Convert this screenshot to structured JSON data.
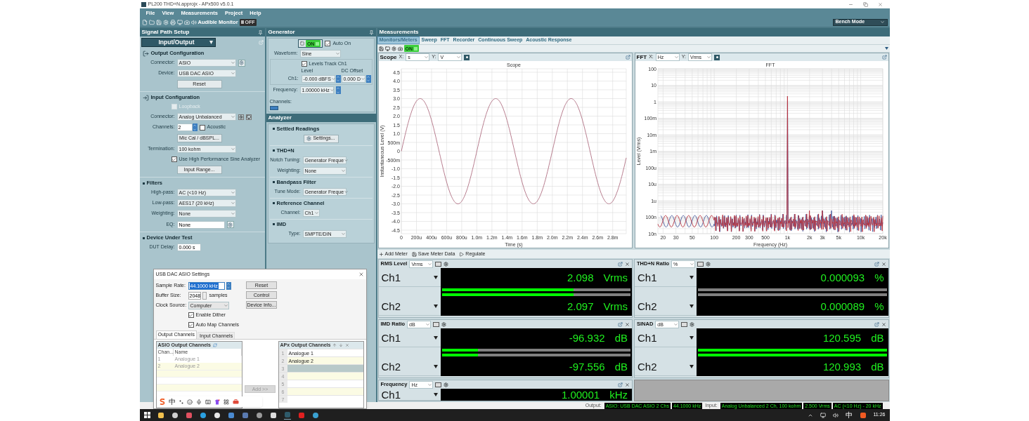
{
  "window": {
    "title": "PL200 THD+N.approjx - APx500 v5.0.1"
  },
  "menu": [
    "File",
    "View",
    "Measurements",
    "Project",
    "Help"
  ],
  "toolbar": {
    "audible_monitor": "Audible Monitor",
    "monitor_toggle": {
      "label": "OFF",
      "on": false
    },
    "mode": "Bench Mode"
  },
  "signal_path": {
    "title": "Signal Path Setup",
    "view": "Input/Output",
    "sections": [
      {
        "title": "Output Configuration",
        "kind": "output",
        "rows": [
          {
            "kind": "select-settings",
            "label": "Connector:",
            "value": "ASIO"
          },
          {
            "kind": "select",
            "label": "Device:",
            "value": "USB DAC ASIO"
          },
          {
            "kind": "button",
            "text": "Reset"
          }
        ]
      },
      {
        "title": "Input Configuration",
        "kind": "input",
        "rows": [
          {
            "kind": "check",
            "label": "Loopback",
            "checked": false,
            "disabled": true
          },
          {
            "kind": "select-tools",
            "label": "Connector:",
            "value": "Analog Unbalanced"
          },
          {
            "kind": "spin-check",
            "label": "Channels:",
            "value": "2",
            "check": {
              "label": "Acoustic",
              "checked": false
            }
          },
          {
            "kind": "button",
            "text": "Mic Cal / dBSPL..."
          },
          {
            "kind": "select",
            "label": "Termination:",
            "value": "100 kohm"
          },
          {
            "kind": "check",
            "label": "Use High Performance Sine Analyzer",
            "checked": true,
            "disabled": false
          },
          {
            "kind": "button",
            "text": "Input Range..."
          }
        ]
      },
      {
        "title": "Filters",
        "kind": "bullet",
        "rows": [
          {
            "kind": "select",
            "label": "High-pass:",
            "value": "AC (<10 Hz)"
          },
          {
            "kind": "select",
            "label": "Low-pass:",
            "value": "AES17 (20 kHz)"
          },
          {
            "kind": "select",
            "label": "Weighting:",
            "value": "None"
          },
          {
            "kind": "field-settings",
            "label": "EQ:",
            "value": "None"
          }
        ]
      },
      {
        "title": "Device Under Test",
        "kind": "bullet",
        "rows": [
          {
            "kind": "field",
            "label": "DUT Delay:",
            "value": "0.000 s"
          }
        ]
      }
    ]
  },
  "generator": {
    "title": "Generator",
    "toggle": {
      "label": "ON",
      "on": true
    },
    "auto_on": {
      "label": "Auto On",
      "checked": true
    },
    "waveform_label": "Waveform:",
    "waveform": "Sine",
    "levels_track": {
      "label": "Levels Track Ch1",
      "checked": true
    },
    "level_heading": "Level",
    "dc_heading": "DC Offset",
    "ch_label": "Ch1:",
    "level": "-0.000 dBFS",
    "dc_offset": "0.000 D",
    "frequency_label": "Frequency:",
    "frequency": "1.00000 kHz",
    "channels_label": "Channels:"
  },
  "analyzer": {
    "title": "Analyzer",
    "sections": [
      {
        "title": "Settled Readings",
        "rows": [
          {
            "kind": "button-settings",
            "text": "Settings..."
          }
        ]
      },
      {
        "title": "THD+N",
        "rows": [
          {
            "kind": "select",
            "label": "Notch Tuning:",
            "value": "Generator Freque"
          },
          {
            "kind": "select",
            "label": "Weighting:",
            "value": "None"
          }
        ]
      },
      {
        "title": "Bandpass Filter",
        "rows": [
          {
            "kind": "select",
            "label": "Tune Mode:",
            "value": "Generator Freque"
          }
        ]
      },
      {
        "title": "Reference Channel",
        "rows": [
          {
            "kind": "select-small",
            "label": "Channel:",
            "value": "Ch1"
          }
        ]
      },
      {
        "title": "IMD",
        "rows": [
          {
            "kind": "select",
            "label": "Type:",
            "value": "SMPTE/DIN"
          }
        ]
      }
    ]
  },
  "measurements": {
    "title": "Measurements",
    "tabs": [
      {
        "label": "Monitors/Meters",
        "selected": true
      },
      {
        "label": "Sweep",
        "selected": false
      },
      {
        "label": "FFT",
        "selected": false
      },
      {
        "label": "Recorder",
        "selected": false
      },
      {
        "label": "Continuous Sweep",
        "selected": false
      },
      {
        "label": "Acoustic Response",
        "selected": false
      }
    ],
    "toggle": {
      "label": "ON",
      "on": true
    },
    "graphs": [
      {
        "name": "Scope",
        "kind": "scope",
        "x_label": "X:",
        "x_unit": "s",
        "y_label": "Y:",
        "y_unit": "V",
        "title": "Scope",
        "xlabel": "Time (s)",
        "ylabel": "Instantaneous Level (V)",
        "xticks": [
          "0",
          "200u",
          "400u",
          "600u",
          "800u",
          "1.0m",
          "1.2m",
          "1.4m",
          "1.6m",
          "1.8m",
          "2.0m",
          "2.2m",
          "2.4m",
          "2.6m",
          "2.8m"
        ],
        "yticks": [
          "4.5",
          "4.0",
          "3.5",
          "3.0",
          "2.5",
          "2.0",
          "1.5",
          "1.0",
          "500m",
          "0",
          "-500m",
          "-1.0",
          "-1.5",
          "-2.0",
          "-2.5",
          "-3.0",
          "-3.5",
          "-4.0",
          "-4.5"
        ]
      },
      {
        "name": "FFT",
        "kind": "fft",
        "x_label": "X:",
        "x_unit": "Hz",
        "y_label": "Y:",
        "y_unit": "Vrms",
        "title": "FFT",
        "xlabel": "Frequency (Hz)",
        "ylabel": "Level (Vrms)",
        "xticks": [
          "20",
          "30",
          "50",
          "100",
          "200",
          "300",
          "500",
          "1k",
          "2k",
          "3k",
          "5k",
          "10k",
          "20k"
        ],
        "yticks": [
          "100",
          "10",
          "1",
          "100m",
          "10m",
          "1m",
          "100u",
          "10u",
          "1u",
          "100n",
          "10n"
        ]
      }
    ],
    "meter_toolbar": [
      "Add Meter",
      "Save Meter Data",
      "Regulate"
    ],
    "meters": [
      {
        "title": "RMS Level",
        "unit": "Vrms",
        "channels": [
          {
            "name": "Ch1",
            "value": "2.098",
            "unit": "Vrms",
            "level": 0.7
          },
          {
            "name": "Ch2",
            "value": "2.097",
            "unit": "Vrms",
            "level": 0.7
          }
        ]
      },
      {
        "title": "THD+N Ratio",
        "unit": "%",
        "channels": [
          {
            "name": "Ch1",
            "value": "0.000093",
            "unit": "%",
            "level": 0
          },
          {
            "name": "Ch2",
            "value": "0.000089",
            "unit": "%",
            "level": 0
          }
        ]
      },
      {
        "title": "IMD Ratio",
        "unit": "dB",
        "channels": [
          {
            "name": "Ch1",
            "value": "-96.932",
            "unit": "dB",
            "level": 0.19
          },
          {
            "name": "Ch2",
            "value": "-97.556",
            "unit": "dB",
            "level": 0.19
          }
        ]
      },
      {
        "title": "SINAD",
        "unit": "dB",
        "channels": [
          {
            "name": "Ch1",
            "value": "120.595",
            "unit": "dB",
            "level": 1
          },
          {
            "name": "Ch2",
            "value": "120.993",
            "unit": "dB",
            "level": 1
          }
        ]
      },
      {
        "title": "Frequency",
        "unit": "Hz",
        "channels": [
          {
            "name": "Ch1",
            "value": "1.00001",
            "unit": "kHz"
          }
        ]
      }
    ]
  },
  "status_bar": {
    "output_label": "Output:",
    "output": [
      "ASIO: USB DAC ASIO 2 Chs",
      "44.1000 kHz"
    ],
    "input_label": "Input:",
    "input": [
      "Analog Unbalanced 2 Ch, 100 kohm",
      "2.500 Vrms",
      "AC (<10 Hz) - 20 kHz"
    ]
  },
  "dialog": {
    "title": "USB DAC ASIO Settings",
    "sample_rate_label": "Sample Rate:",
    "sample_rate": "44.1000 kHz",
    "buffer_label": "Buffer Size:",
    "buffer": "2048",
    "buffer_unit": "samples",
    "clock_label": "Clock Source:",
    "clock": "Computer",
    "checks": [
      {
        "label": "Enable Dither",
        "checked": true
      },
      {
        "label": "Auto Map Channels",
        "checked": true
      }
    ],
    "buttons": [
      "Reset",
      "Control",
      "Device Info..."
    ],
    "tabs": [
      {
        "label": "Output Channels",
        "selected": true
      },
      {
        "label": "Input Channels",
        "selected": false
      }
    ],
    "left_table": {
      "title": "ASIO Output Channels",
      "columns": [
        "Chan...",
        "Name"
      ],
      "rows": [
        [
          "1",
          "Analogue 1"
        ],
        [
          "2",
          "Analogue 2"
        ]
      ]
    },
    "add_button": {
      "text": "Add >>",
      "disabled": true
    },
    "right_table": {
      "title": "APx Output Channels",
      "rows": [
        {
          "num": "1",
          "name": "Analogue 1",
          "selected": false
        },
        {
          "num": "2",
          "name": "Analogue 2",
          "selected": false
        },
        {
          "num": "3",
          "selected": true
        },
        {
          "num": "4",
          "selected": false
        },
        {
          "num": "5",
          "selected": false
        },
        {
          "num": "6",
          "selected": false
        },
        {
          "num": "7",
          "selected": false
        }
      ]
    }
  },
  "ime_bar": {
    "mode": "中"
  },
  "taskbar": {
    "ime": "中",
    "time": "11:26"
  }
}
